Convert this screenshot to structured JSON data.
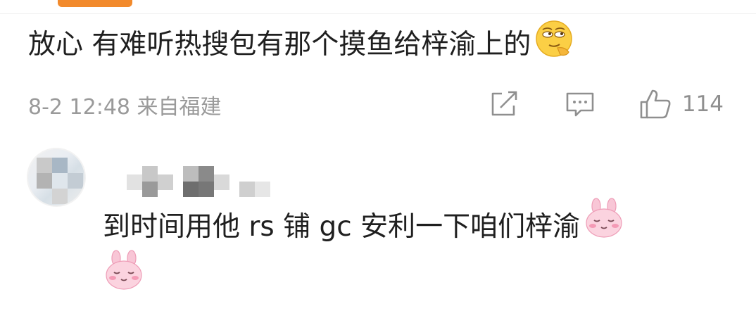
{
  "comment": {
    "text": "放心 有难听热搜包有那个摸鱼给梓渝上的",
    "emoji_icon": "smirk-hand-on-chin-emoji",
    "meta": "8-2 12:48 来自福建",
    "like_count": "114"
  },
  "reply": {
    "line1": "到时间用他 rs 铺 gc 安利一下咱们梓渝",
    "emoji_icon": "pink-bunny-emoji"
  },
  "icons": {
    "share": "share-edit-icon",
    "comment": "comment-bubble-icon",
    "like": "thumbs-up-icon"
  },
  "colors": {
    "accent": "#f28a2c",
    "meta_text": "#9a9a9a",
    "body_text": "#1f1f1f"
  }
}
